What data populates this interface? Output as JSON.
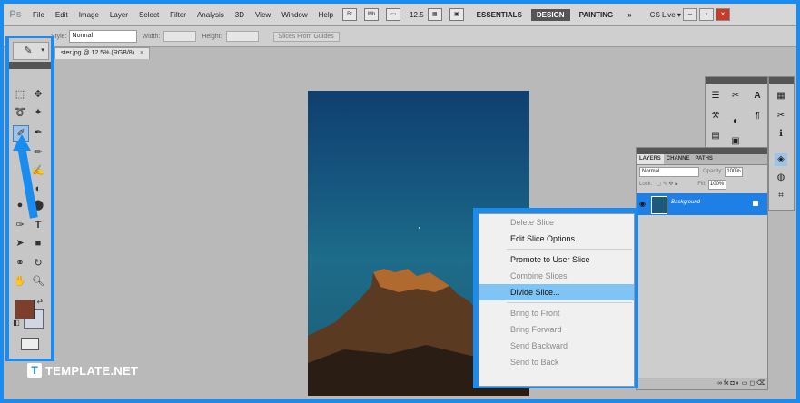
{
  "app": {
    "logo": "Ps"
  },
  "menu": [
    "File",
    "Edit",
    "Image",
    "Layer",
    "Select",
    "Filter",
    "Analysis",
    "3D",
    "View",
    "Window",
    "Help"
  ],
  "toolbar": {
    "zoom": "12.5",
    "icons": [
      "Br",
      "Mb"
    ]
  },
  "workspaces": {
    "essentials": "ESSENTIALS",
    "design": "DESIGN",
    "painting": "PAINTING",
    "more": "»"
  },
  "cs_live": "CS Live ▾",
  "options": {
    "style_label": "Style:",
    "style_value": "Normal",
    "width_label": "Width:",
    "height_label": "Height:",
    "slices_button": "Slices From Guides"
  },
  "document": {
    "tab_title": "ster.jpg @ 12.5% (RGB/8)",
    "close": "×"
  },
  "context_menu": {
    "items": [
      {
        "label": "Delete Slice",
        "disabled": true
      },
      {
        "label": "Edit Slice Options...",
        "disabled": false
      },
      {
        "sep": true
      },
      {
        "label": "Promote to User Slice",
        "disabled": false
      },
      {
        "label": "Combine Slices",
        "disabled": true
      },
      {
        "label": "Divide Slice...",
        "disabled": false,
        "highlighted": true
      },
      {
        "sep": true
      },
      {
        "label": "Bring to Front",
        "disabled": true
      },
      {
        "label": "Bring Forward",
        "disabled": true
      },
      {
        "label": "Send Backward",
        "disabled": true
      },
      {
        "label": "Send to Back",
        "disabled": true
      }
    ]
  },
  "layers_panel": {
    "tabs": [
      "LAYERS",
      "CHANNE",
      "PATHS"
    ],
    "blend_mode": "Normal",
    "opacity_label": "Opacity:",
    "opacity": "100%",
    "lock_label": "Lock:",
    "fill_label": "Fill:",
    "fill": "100%",
    "layer_name": "Background",
    "footer_icons": "∞ fx ◘ ◐ ▭ ◻ ⌫"
  },
  "watermark": {
    "logo": "T",
    "text": "TEMPLATE.NET"
  },
  "colors": {
    "accent": "#1a8cf0",
    "foreground": "#7b3f2c",
    "background_color": "#cfd6e6",
    "highlight": "#7fc4f5"
  }
}
